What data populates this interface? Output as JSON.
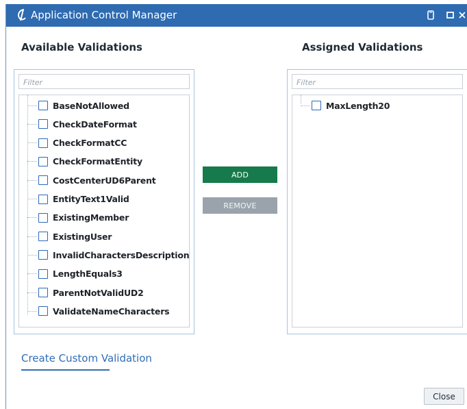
{
  "window": {
    "title": "Application Control Manager"
  },
  "available": {
    "heading": "Available Validations",
    "filter_placeholder": "Filter",
    "items": [
      {
        "label": "BaseNotAllowed",
        "checked": false
      },
      {
        "label": "CheckDateFormat",
        "checked": false
      },
      {
        "label": "CheckFormatCC",
        "checked": false
      },
      {
        "label": "CheckFormatEntity",
        "checked": false
      },
      {
        "label": "CostCenterUD6Parent",
        "checked": false
      },
      {
        "label": "EntityText1Valid",
        "checked": false
      },
      {
        "label": "ExistingMember",
        "checked": false
      },
      {
        "label": "ExistingUser",
        "checked": false
      },
      {
        "label": "InvalidCharactersDescription",
        "checked": false
      },
      {
        "label": "LengthEquals3",
        "checked": false
      },
      {
        "label": "ParentNotValidUD2",
        "checked": false
      },
      {
        "label": "ValidateNameCharacters",
        "checked": false
      }
    ]
  },
  "assigned": {
    "heading": "Assigned Validations",
    "filter_placeholder": "Filter",
    "items": [
      {
        "label": "MaxLength20",
        "checked": false
      }
    ]
  },
  "actions": {
    "add_label": "ADD",
    "remove_label": "REMOVE"
  },
  "footer": {
    "custom_link": "Create Custom Validation",
    "close_label": "Close"
  },
  "colors": {
    "titlebar": "#2e6bb1",
    "add_button": "#177a4c",
    "remove_button": "#9aa3ab",
    "checkbox_border": "#2b69b5",
    "link": "#2f6db5"
  },
  "icons": {
    "app": "app-logo-icon",
    "restore": "restore-icon",
    "maximize": "maximize-icon",
    "close": "close-icon"
  }
}
